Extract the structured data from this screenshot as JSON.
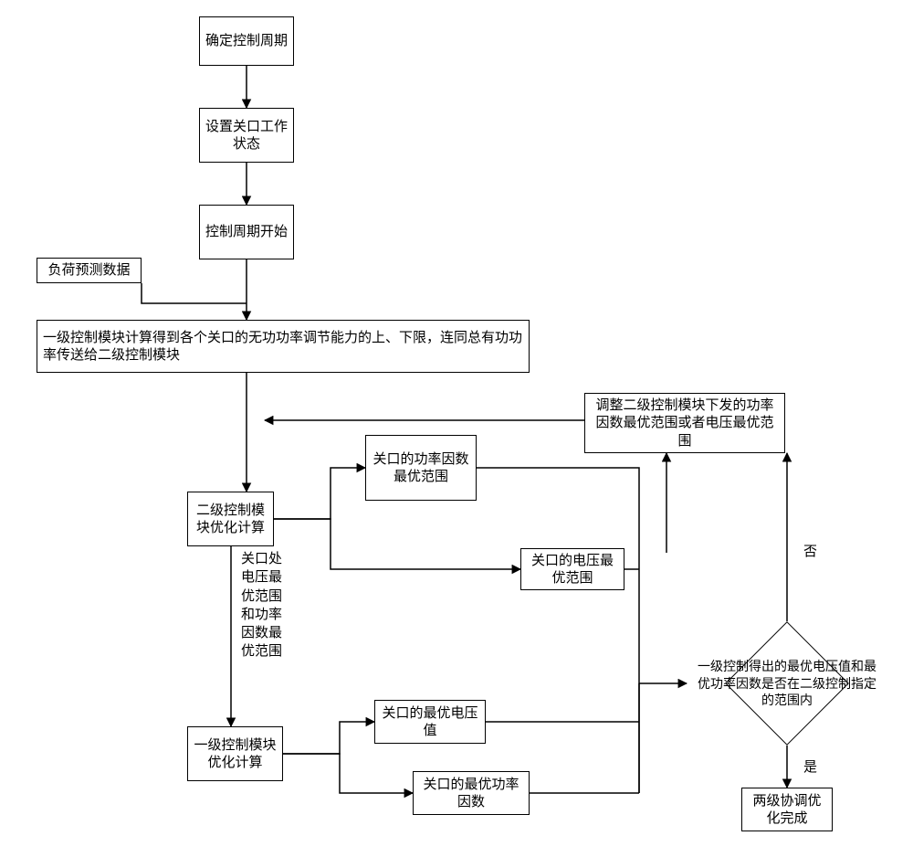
{
  "chart_data": {
    "type": "flowchart",
    "nodes": [
      {
        "id": "n1",
        "shape": "rect",
        "text": "确定控制周期"
      },
      {
        "id": "n2",
        "shape": "rect",
        "text": "设置关口工作状态"
      },
      {
        "id": "n3",
        "shape": "rect",
        "text": "控制周期开始"
      },
      {
        "id": "n4",
        "shape": "rect",
        "text": "负荷预测数据"
      },
      {
        "id": "n5",
        "shape": "rect",
        "text": "一级控制模块计算得到各个关口的无功功率调节能力的上、下限，连同总有功功率传送给二级控制模块"
      },
      {
        "id": "n6",
        "shape": "rect",
        "text": "二级控制模块优化计算"
      },
      {
        "id": "n7",
        "shape": "rect",
        "text": "关口的功率因数最优范围"
      },
      {
        "id": "n8",
        "shape": "rect",
        "text": "关口的电压最优范围"
      },
      {
        "id": "n9",
        "shape": "rect",
        "text": "调整二级控制模块下发的功率因数最优范围或者电压最优范围"
      },
      {
        "id": "L1",
        "shape": "label",
        "text": "关口处电压最优范围和功率因数最优范围"
      },
      {
        "id": "n10",
        "shape": "rect",
        "text": "一级控制模块优化计算"
      },
      {
        "id": "n11",
        "shape": "rect",
        "text": "关口的最优电压值"
      },
      {
        "id": "n12",
        "shape": "rect",
        "text": "关口的最优功率因数"
      },
      {
        "id": "D1",
        "shape": "diamond",
        "text": "一级控制得出的最优电压值和最优功率因数是否在二级控制指定的范围内"
      },
      {
        "id": "n13",
        "shape": "rect",
        "text": "两级协调优化完成"
      },
      {
        "id": "L_no",
        "shape": "label",
        "text": "否"
      },
      {
        "id": "L_yes",
        "shape": "label",
        "text": "是"
      }
    ],
    "edges": [
      {
        "from": "n1",
        "to": "n2",
        "arrow": true
      },
      {
        "from": "n2",
        "to": "n3",
        "arrow": true
      },
      {
        "from": "n4",
        "to": "n3_to_n5_line",
        "arrow": false
      },
      {
        "from": "n3",
        "to": "n5",
        "arrow": true
      },
      {
        "from": "n5",
        "to": "n6",
        "arrow": true
      },
      {
        "from": "n6",
        "to": "n7",
        "arrow": true
      },
      {
        "from": "n6",
        "to": "n8",
        "arrow": true
      },
      {
        "from": "n6",
        "to": "n10",
        "arrow": true,
        "via_label": "L1"
      },
      {
        "from": "n10",
        "to": "n11",
        "arrow": true
      },
      {
        "from": "n10",
        "to": "n12",
        "arrow": true
      },
      {
        "from": "n7",
        "to": "D1_collector",
        "arrow": false
      },
      {
        "from": "n8",
        "to": "D1_collector",
        "arrow": false
      },
      {
        "from": "n11",
        "to": "D1_collector",
        "arrow": false
      },
      {
        "from": "n12",
        "to": "D1",
        "arrow": true
      },
      {
        "from": "D1",
        "to": "n9",
        "arrow": true,
        "label": "否"
      },
      {
        "from": "n9",
        "to": "n5_to_n6_line",
        "arrow": true,
        "feedback": true
      },
      {
        "from": "D1",
        "to": "n13",
        "arrow": true,
        "label": "是"
      }
    ]
  }
}
